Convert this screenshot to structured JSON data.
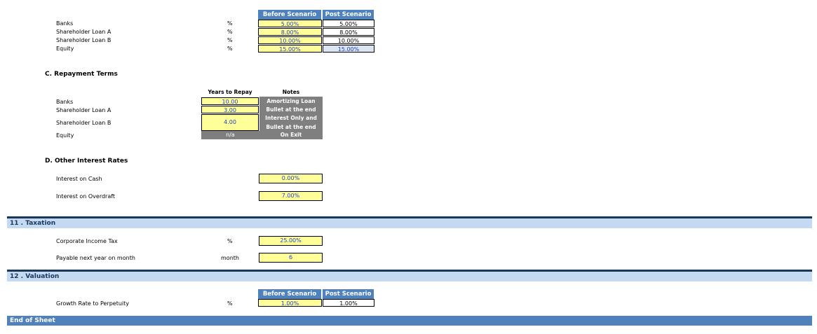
{
  "rates": {
    "col_before": "Before Scenario",
    "col_post": "Post Scenario",
    "rows": [
      {
        "label": "Banks",
        "unit": "%",
        "before": "5.00%",
        "post": "5.00%"
      },
      {
        "label": "Shareholder Loan A",
        "unit": "%",
        "before": "8.00%",
        "post": "8.00%"
      },
      {
        "label": "Shareholder Loan B",
        "unit": "%",
        "before": "10.00%",
        "post": "10.00%"
      },
      {
        "label": "Equity",
        "unit": "%",
        "before": "15.00%",
        "post": "15.00%"
      }
    ]
  },
  "repayment": {
    "title": "C.  Repayment Terms",
    "col_years": "Years to Repay",
    "col_notes": "Notes",
    "rows": [
      {
        "label": "Banks",
        "years": "10.00",
        "note": "Amortizing Loan"
      },
      {
        "label": "Shareholder Loan A",
        "years": "3.00",
        "note": "Bullet at the end"
      },
      {
        "label": "Shareholder Loan B",
        "years": "4.00",
        "note_line1": "Interest Only and",
        "note_line2": "Bullet at the end"
      },
      {
        "label": "Equity",
        "years": "n/a",
        "note": "On Exit"
      }
    ]
  },
  "other_rates": {
    "title": "D.  Other Interest Rates",
    "rows": [
      {
        "label": "Interest on Cash",
        "value": "0.00%"
      },
      {
        "label": "Interest on Overdraft",
        "value": "7.00%"
      }
    ]
  },
  "taxation": {
    "title": "11 .  Taxation",
    "rows": [
      {
        "label": "Corporate Income Tax",
        "unit": "%",
        "value": "25.00%"
      },
      {
        "label": "Payable next year on month",
        "unit": "month",
        "value": "6"
      }
    ]
  },
  "valuation": {
    "title": "12 .  Valuation",
    "col_before": "Before Scenario",
    "col_post": "Post Scenario",
    "row": {
      "label": "Growth Rate to Perpetuity",
      "unit": "%",
      "before": "1.00%",
      "post": "1.00%"
    }
  },
  "end_label": "End of Sheet"
}
